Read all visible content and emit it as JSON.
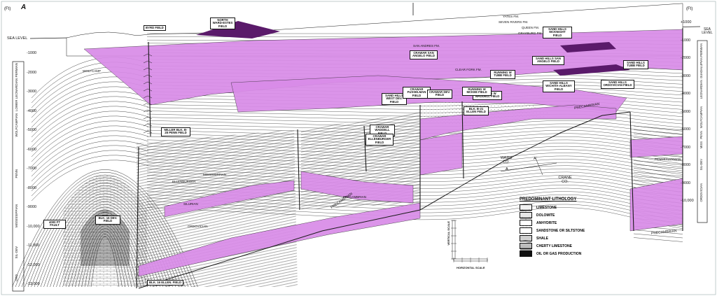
{
  "figure_letter": "A",
  "unit_left": "(Ft)",
  "unit_right": "(Ft)",
  "sea_level_left": "SEA LEVEL",
  "sea_level_right": "SEA LEVEL",
  "depth_left": [
    "-1000",
    "-2000",
    "-3000",
    "-4000",
    "-5000",
    "-6000",
    "-7000",
    "-8000",
    "-9000",
    "-10,000",
    "-11,000",
    "-12,000",
    "-13,000"
  ],
  "depth_right": [
    "+1000",
    "-1000",
    "-2000",
    "-3000",
    "-4000",
    "-5000",
    "-6000",
    "-7000",
    "-8000",
    "-9000",
    "-10,000"
  ],
  "left_strat": [
    "PERMIAN",
    "LOWER LEONARDIAN",
    "WOLFCAMPIAN",
    "PENN",
    "MISSISSIPPIAN",
    "SIL-DEV",
    "ORD"
  ],
  "right_strat": [
    "PERMIAN",
    "GUADALUPIAN",
    "LEONARDIAN",
    "WOLFCAMPIAN",
    "PENN",
    "MISS",
    "SIL-DEV",
    "ORDOVICIAN"
  ],
  "field_labels": [
    {
      "text": "NORTH WARD-ESTES FIELD"
    },
    {
      "text": "BYRD FIELD"
    },
    {
      "text": "CRAWAR SAN ANGELO FIELD"
    },
    {
      "text": "SAND HILLS MCKNIGHT FIELD"
    },
    {
      "text": "SAND HILLS SAN ANGELO FIELD"
    },
    {
      "text": "SAND HILLS TUBB FIELD"
    },
    {
      "text": "RUNNING W TUBB FIELD"
    },
    {
      "text": "SAND HILLS WICHITA-ALBANY FIELD"
    },
    {
      "text": "SAND HILLS ORDOVICIAN FIELD"
    },
    {
      "text": "SAND HILLS WEST DEV. FIELD"
    },
    {
      "text": "CRAWAR FUSSELMAN FIELD"
    },
    {
      "text": "CRAWAR DEV. FIELD"
    },
    {
      "text": "RUNNING W WADDELL FIELD"
    },
    {
      "text": "RUNNING W MCKEE FIELD"
    },
    {
      "text": "BLK. B-21 ELLEN FIELD"
    },
    {
      "text": "CRAWAR WADDELL FIELD"
    },
    {
      "text": "CRAWAR ELLENBURGER FIELD"
    },
    {
      "text": "MILLER BLK. B-28 PENN FIELD"
    },
    {
      "text": "BLK. 16 DEV. FIELD"
    },
    {
      "text": "BLK. 16 ELLEN. FIELD"
    },
    {
      "text": "4000 FT FAULT"
    }
  ],
  "formation_labels": [
    "YATES FM.",
    "SEVEN RIVERS FM.",
    "QUEEN FM.",
    "GRAYBURG FM.",
    "SAN ANDRES FM.",
    "CLEAR FORK FM.",
    "MISSISSIPPIAN",
    "SILURIAN",
    "ORDOVICIAN",
    "PRECAMBRIAN",
    "PENNSYLVANIAN",
    "WOLFCAMP",
    "ELLENBURGER"
  ],
  "precambrian_labels": [
    "PRECAMBRIAN",
    "PRECAMBRIAN",
    "PRECAMBRIAN"
  ],
  "section_line": {
    "ward": "WARD CO.",
    "crane": "CRANE CO.",
    "a": "A",
    "a_prime": "A'"
  },
  "scales": {
    "vertical": "VERTICAL SCALE",
    "horizontal": "HORIZONTAL SCALE"
  },
  "legend": {
    "title": "PREDOMINANT LITHOLOGY",
    "items": [
      {
        "label": "LIMESTONE",
        "color": "#f2f2f2"
      },
      {
        "label": "DOLOMITE",
        "color": "#e6e6e6"
      },
      {
        "label": "ANHYDRITE",
        "color": "#ffffff"
      },
      {
        "label": "SANDSTONE OR SILTSTONE",
        "color": "#ffffff"
      },
      {
        "label": "SHALE",
        "color": "#d0d0d0"
      },
      {
        "label": "CHERTY LIMESTONE",
        "color": "#bcbcbc"
      },
      {
        "label": "OIL OR GAS PRODUCTION",
        "color": "#111111"
      }
    ]
  },
  "colors": {
    "highlight": "#d98ce8",
    "highlight_dark": "#5a1a6a",
    "line": "#1a1a1a",
    "background": "#ffffff"
  }
}
